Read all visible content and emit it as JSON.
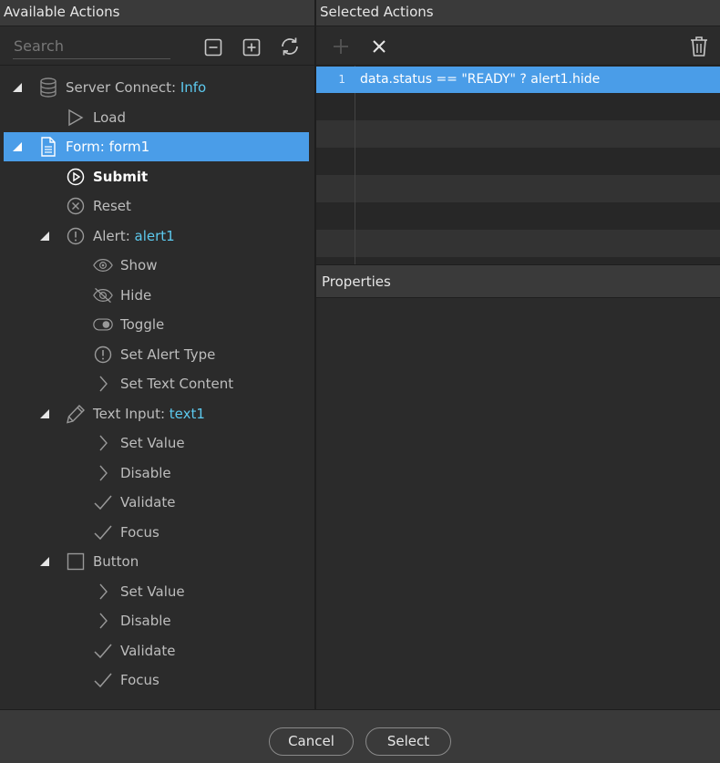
{
  "left_panel": {
    "title": "Available Actions",
    "search_placeholder": "Search"
  },
  "right_panel": {
    "title": "Selected Actions",
    "line_number": "1",
    "code_line": "data.status == \"READY\" ? alert1.hide"
  },
  "properties": {
    "title": "Properties"
  },
  "tree": {
    "server_connect": {
      "label": "Server Connect: ",
      "value": "Info"
    },
    "load": "Load",
    "form": {
      "label": "Form: form1"
    },
    "submit": "Submit",
    "reset": "Reset",
    "alert": {
      "label": "Alert: ",
      "value": "alert1"
    },
    "show": "Show",
    "hide": "Hide",
    "toggle": "Toggle",
    "set_alert_type": "Set Alert Type",
    "set_text_content": "Set Text Content",
    "text_input": {
      "label": "Text Input: ",
      "value": "text1"
    },
    "ti_set_value": "Set Value",
    "ti_disable": "Disable",
    "ti_validate": "Validate",
    "ti_focus": "Focus",
    "button": {
      "label": "Button"
    },
    "b_set_value": "Set Value",
    "b_disable": "Disable",
    "b_validate": "Validate",
    "b_focus": "Focus"
  },
  "footer": {
    "cancel": "Cancel",
    "select": "Select"
  },
  "colors": {
    "accent": "#4a9de8",
    "highlight_text": "#5cc9ee"
  }
}
